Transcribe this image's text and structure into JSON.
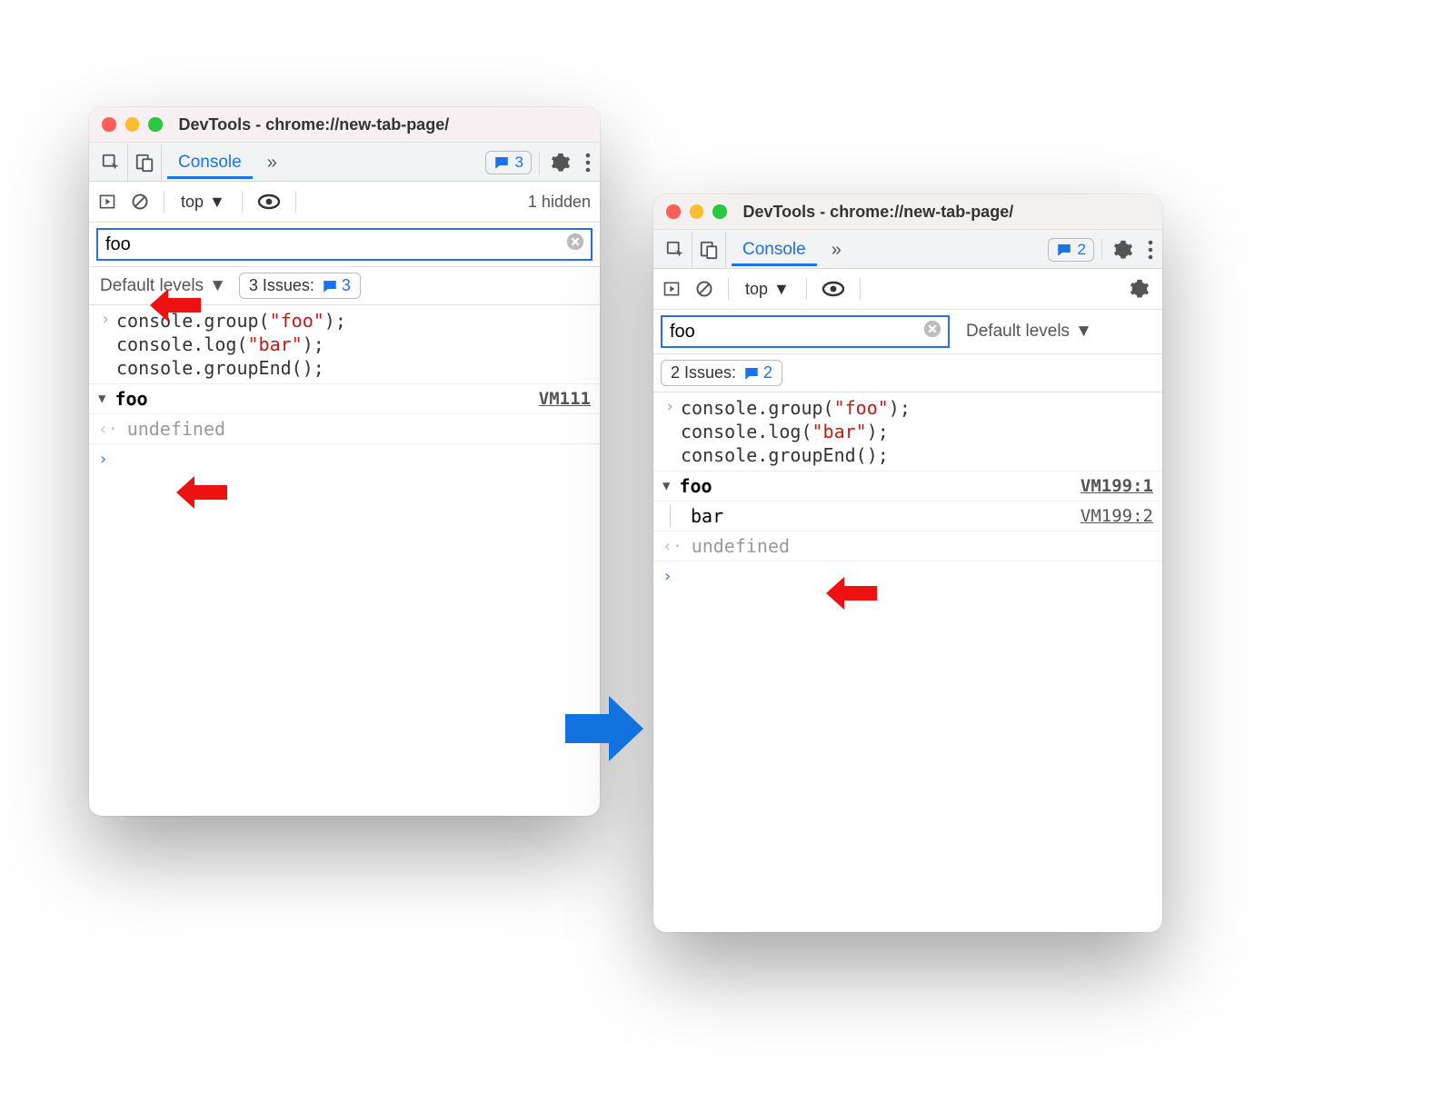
{
  "left": {
    "title": "DevTools - chrome://new-tab-page/",
    "tab": "Console",
    "toolbar_issue_count": "3",
    "context": "top",
    "hidden": "1 hidden",
    "filter_value": "foo",
    "levels": "Default levels",
    "issues_label": "3 Issues:",
    "issues_count": "3",
    "code_line1a": "console.group(",
    "code_str1": "\"foo\"",
    "code_line1b": ");",
    "code_line2a": "console.log(",
    "code_str2": "\"bar\"",
    "code_line2b": ");",
    "code_line3": "console.groupEnd();",
    "group_name": "foo",
    "group_src": "VM111",
    "undefined": "undefined"
  },
  "right": {
    "title": "DevTools - chrome://new-tab-page/",
    "tab": "Console",
    "toolbar_issue_count": "2",
    "context": "top",
    "filter_value": "foo",
    "levels": "Default levels",
    "issues_label": "2 Issues:",
    "issues_count": "2",
    "code_line1a": "console.group(",
    "code_str1": "\"foo\"",
    "code_line1b": ");",
    "code_line2a": "console.log(",
    "code_str2": "\"bar\"",
    "code_line2b": ");",
    "code_line3": "console.groupEnd();",
    "group_name": "foo",
    "group_src": "VM199:1",
    "bar_label": "bar",
    "bar_src": "VM199:2",
    "undefined": "undefined"
  }
}
